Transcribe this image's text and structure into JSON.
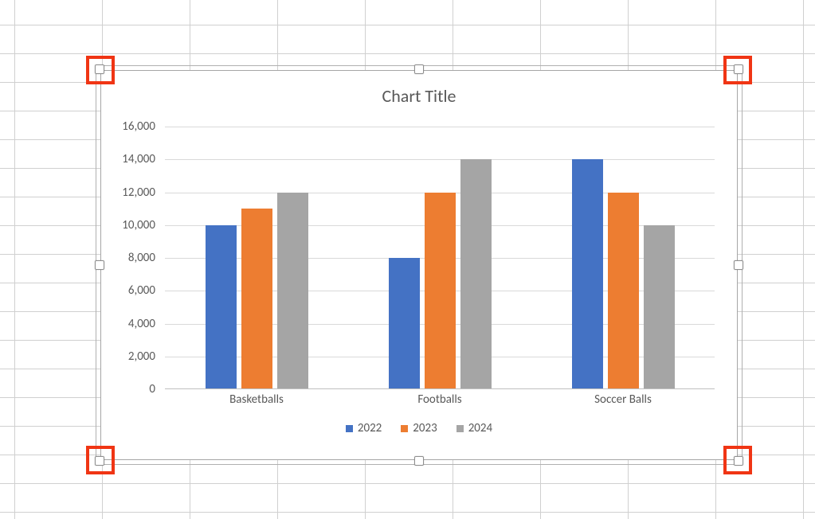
{
  "chart_data": {
    "type": "bar",
    "title": "Chart Title",
    "categories": [
      "Basketballs",
      "Footballs",
      "Soccer Balls"
    ],
    "series": [
      {
        "name": "2022",
        "values": [
          10000,
          8000,
          14000
        ],
        "color": "#4472c4"
      },
      {
        "name": "2023",
        "values": [
          11000,
          12000,
          12000
        ],
        "color": "#ed7d31"
      },
      {
        "name": "2024",
        "values": [
          12000,
          14000,
          10000
        ],
        "color": "#a5a5a5"
      }
    ],
    "ylim": [
      0,
      16000
    ],
    "ytick_step": 2000,
    "ytick_labels": [
      "0",
      "2,000",
      "4,000",
      "6,000",
      "8,000",
      "10,000",
      "12,000",
      "14,000",
      "16,000"
    ],
    "xlabel": "",
    "ylabel": ""
  },
  "annotations": {
    "highlight_corners": true,
    "highlight_color": "#f03514"
  }
}
